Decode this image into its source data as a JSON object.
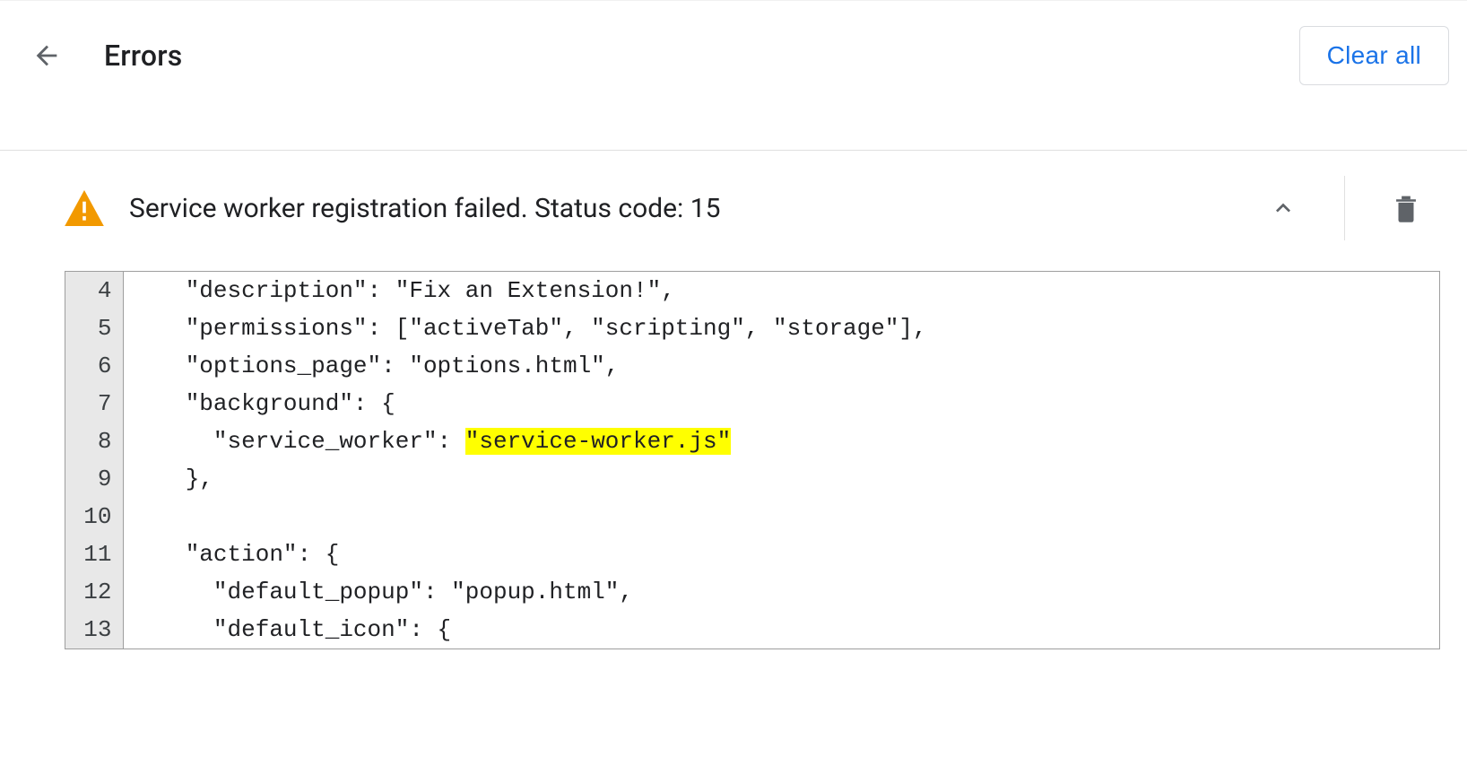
{
  "header": {
    "title": "Errors",
    "clear_all_label": "Clear all"
  },
  "error": {
    "title": "Service worker registration failed. Status code: 15"
  },
  "code": {
    "lines": [
      {
        "n": 4,
        "pre": "  \"description\": \"Fix an Extension!\",",
        "hl": "",
        "post": ""
      },
      {
        "n": 5,
        "pre": "  \"permissions\": [\"activeTab\", \"scripting\", \"storage\"],",
        "hl": "",
        "post": ""
      },
      {
        "n": 6,
        "pre": "  \"options_page\": \"options.html\",",
        "hl": "",
        "post": ""
      },
      {
        "n": 7,
        "pre": "  \"background\": {",
        "hl": "",
        "post": ""
      },
      {
        "n": 8,
        "pre": "    \"service_worker\": ",
        "hl": "\"service-worker.js\"",
        "post": ""
      },
      {
        "n": 9,
        "pre": "  },",
        "hl": "",
        "post": ""
      },
      {
        "n": 10,
        "pre": "",
        "hl": "",
        "post": ""
      },
      {
        "n": 11,
        "pre": "  \"action\": {",
        "hl": "",
        "post": ""
      },
      {
        "n": 12,
        "pre": "    \"default_popup\": \"popup.html\",",
        "hl": "",
        "post": ""
      },
      {
        "n": 13,
        "pre": "    \"default_icon\": {",
        "hl": "",
        "post": ""
      }
    ]
  }
}
